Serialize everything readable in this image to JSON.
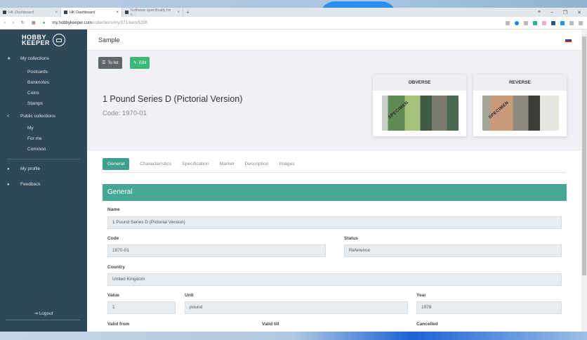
{
  "browser": {
    "tabs": [
      {
        "label": "HK Dashboard"
      },
      {
        "label": "HK Dashboard"
      },
      {
        "label": "Software specifically for c..."
      }
    ],
    "url_host": "my.hobbykeeper.com",
    "url_path": "/collections/my/371/item/5336"
  },
  "sidebar": {
    "logo_line1": "HOBBY",
    "logo_line2": "KEEPER",
    "my_collections": "My collections",
    "collections": [
      "Postcards",
      "Banknotes",
      "Coins",
      "Stamps"
    ],
    "public_collections": "Public collections",
    "public": [
      "My",
      "For me",
      "Common"
    ],
    "profile": "My profile",
    "feedback": "Feedback",
    "logout": "Logout"
  },
  "header": {
    "title": "Sample"
  },
  "item": {
    "to_list": "To list",
    "edit": "Edit",
    "title": "1 Pound Series D (Pictorial Version)",
    "code": "Code: 1970-01",
    "obverse": "OBVERSE",
    "reverse": "REVERSE",
    "specimen": "SPECIMEN"
  },
  "tabs": [
    "General",
    "Characteristics",
    "Specification",
    "Market",
    "Description",
    "Images"
  ],
  "general": {
    "heading": "General",
    "name_label": "Name",
    "name": "1 Pound Series D (Pictorial Version)",
    "code_label": "Code",
    "code": "1970-01",
    "status_label": "Status",
    "status": "Reference",
    "country_label": "Country",
    "country": "United Kingdom",
    "value_label": "Value",
    "value": "1",
    "unit_label": "Unit",
    "unit": "pound",
    "year_label": "Year",
    "year": "1978",
    "valid_from_label": "Valid from",
    "valid_till_label": "Valid till",
    "cancelled_label": "Cancelled"
  },
  "colors": {
    "sidebar": "#2e4759",
    "accent": "#46a797",
    "edit": "#3cb878",
    "tolist": "#5f656b"
  }
}
